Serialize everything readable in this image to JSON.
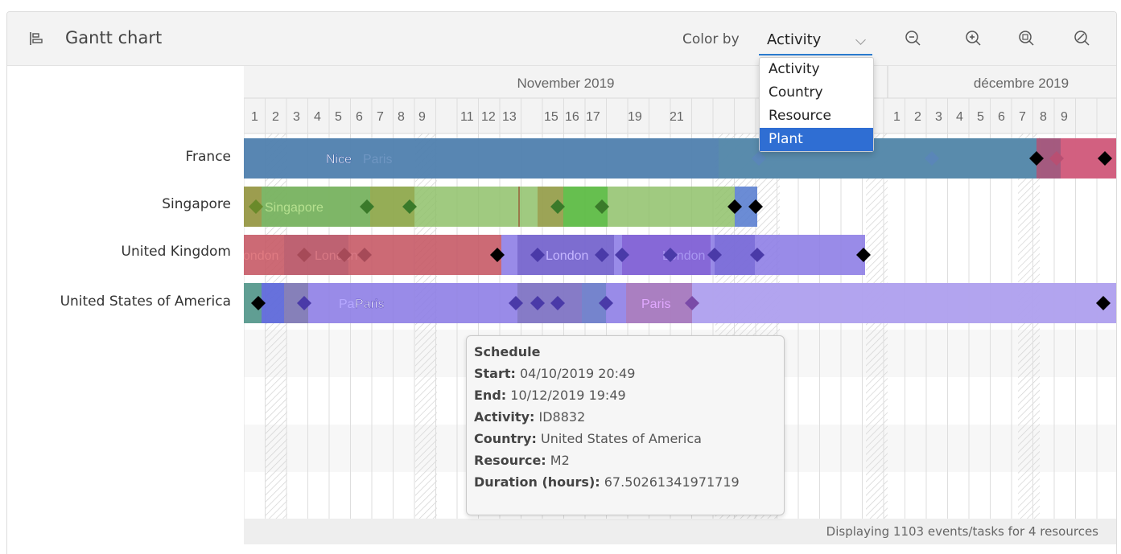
{
  "header": {
    "title": "Gantt chart",
    "color_by_label": "Color by",
    "color_by_value": "Activity",
    "dropdown_options": [
      "Activity",
      "Country",
      "Resource",
      "Plant"
    ],
    "dropdown_highlighted": "Plant",
    "tools": [
      "zoom-out-icon",
      "zoom-in-icon",
      "zoom-fit-icon",
      "zoom-reset-icon"
    ]
  },
  "timeline": {
    "months": [
      "November 2019",
      "décembre 2019"
    ],
    "november_days": [
      "1",
      "2",
      "3",
      "4",
      "5",
      "6",
      "7",
      "8",
      "9",
      "11",
      "12",
      "13",
      "15",
      "16",
      "17",
      "19",
      "21"
    ],
    "december_days": [
      "1",
      "2",
      "3",
      "4",
      "5",
      "6",
      "7",
      "8",
      "9"
    ]
  },
  "rows": [
    {
      "label": "France"
    },
    {
      "label": "Singapore"
    },
    {
      "label": "United Kingdom"
    },
    {
      "label": "United States of America"
    }
  ],
  "bar_labels": {
    "france": [
      "Nice",
      "Paris"
    ],
    "singapore": [
      "Singapore"
    ],
    "uk": [
      "London",
      "London",
      "London",
      "London"
    ],
    "usa": [
      "Pa",
      "Paris",
      "Paris"
    ]
  },
  "colors": {
    "blue": "#4f7fae",
    "green": "#8fc16a",
    "red": "#c65a66",
    "purple": "#8e7ee6",
    "accent": "#2f6ed3"
  },
  "tooltip": {
    "title": "Schedule",
    "start_label": "Start:",
    "start_value": "04/10/2019 20:49",
    "end_label": "End:",
    "end_value": "10/12/2019 19:49",
    "activity_label": "Activity:",
    "activity_value": "ID8832",
    "country_label": "Country:",
    "country_value": "United States of America",
    "resource_label": "Resource:",
    "resource_value": "M2",
    "duration_label": "Duration (hours):",
    "duration_value": "67.50261341971719"
  },
  "footer": {
    "status": "Displaying 1103 events/tasks for 4 resources"
  }
}
